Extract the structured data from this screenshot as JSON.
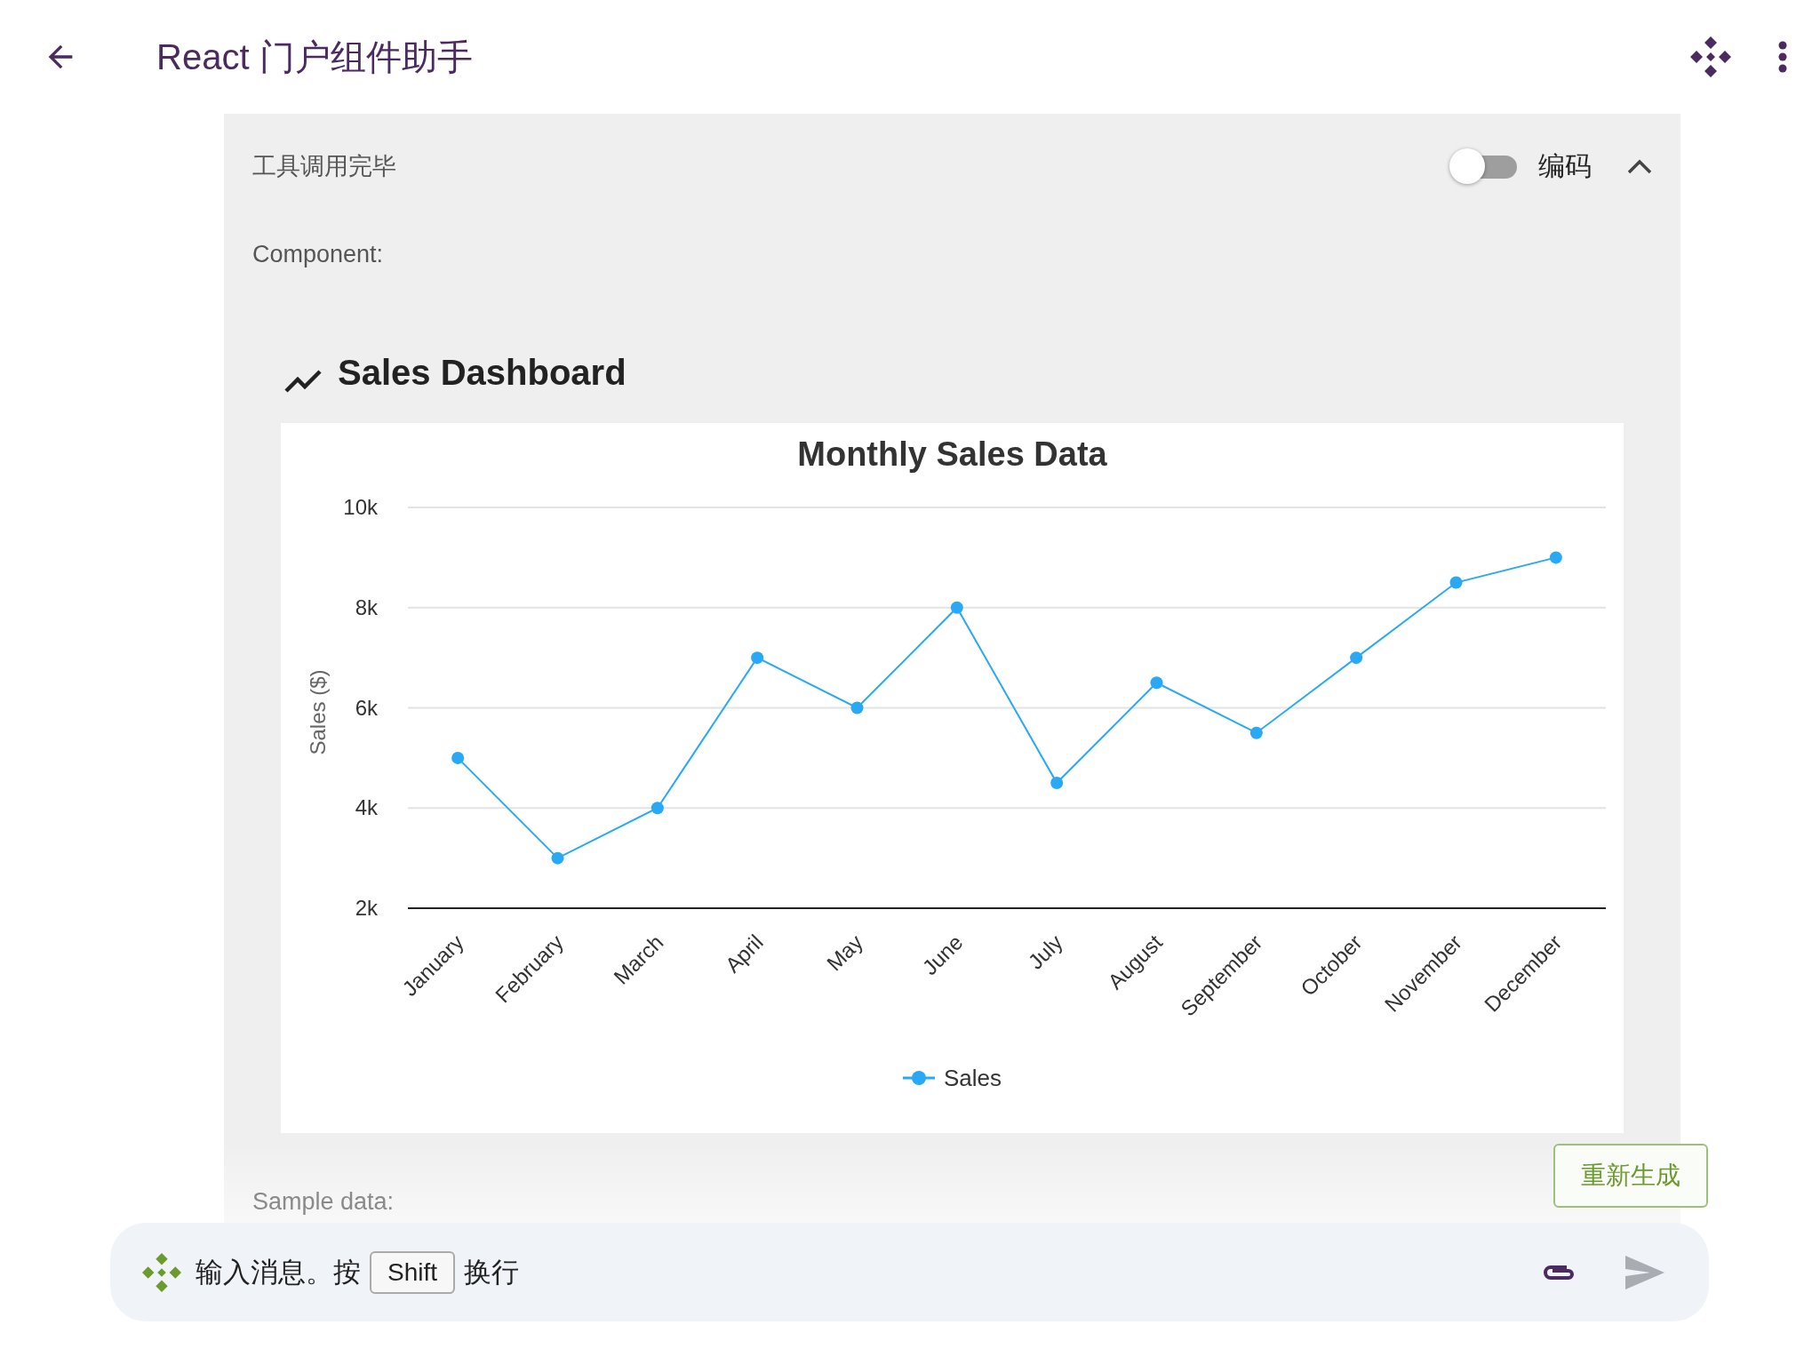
{
  "app_bar": {
    "title": "React 门户组件助手"
  },
  "tool_panel": {
    "status": "工具调用完毕",
    "code_toggle": {
      "label": "编码",
      "on": false
    },
    "expanded": true,
    "component_label": "Component:",
    "dashboard_title": "Sales Dashboard",
    "chart_data": {
      "type": "line",
      "title": "Monthly Sales Data",
      "ylabel": "Sales ($)",
      "categories": [
        "January",
        "February",
        "March",
        "April",
        "May",
        "June",
        "July",
        "August",
        "September",
        "October",
        "November",
        "December"
      ],
      "series": [
        {
          "name": "Sales",
          "color": "#29a9f5",
          "marker": "circle",
          "values": [
            5000,
            3000,
            4000,
            7000,
            6000,
            8000,
            4500,
            6500,
            5500,
            7000,
            8500,
            9000
          ]
        }
      ],
      "grid": true,
      "ylim": [
        2000,
        10000
      ],
      "yticks": [
        {
          "value": 2000,
          "label": "2k"
        },
        {
          "value": 4000,
          "label": "4k"
        },
        {
          "value": 6000,
          "label": "6k"
        },
        {
          "value": 8000,
          "label": "8k"
        },
        {
          "value": 10000,
          "label": "10k"
        }
      ]
    },
    "footer_text": "Sample data:"
  },
  "regenerate_button": "重新生成",
  "chat_input": {
    "placeholder_before": "输入消息。按",
    "key": "Shift",
    "placeholder_after": "换行"
  }
}
